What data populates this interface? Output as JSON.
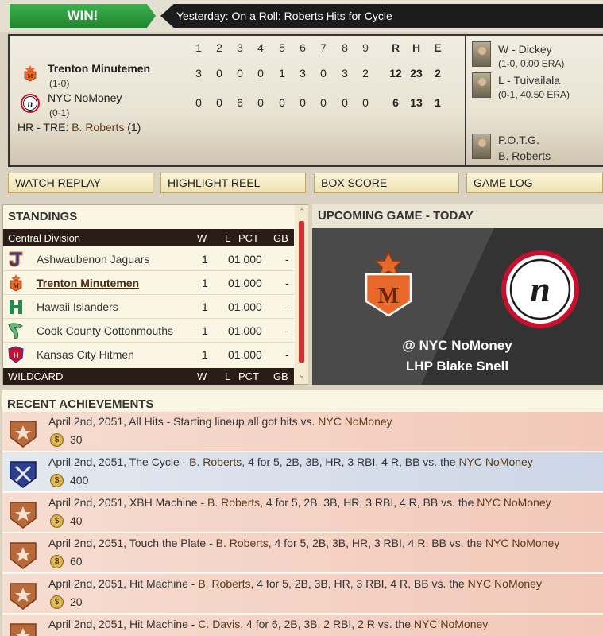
{
  "top": {
    "result": "WIN!",
    "headline": "Yesterday: On a Roll: Roberts Hits for Cycle"
  },
  "boxscore": {
    "innings": [
      "1",
      "2",
      "3",
      "4",
      "5",
      "6",
      "7",
      "8",
      "9"
    ],
    "rhe_labels": [
      "R",
      "H",
      "E"
    ],
    "teams": [
      {
        "name": "Trenton Minutemen",
        "record": "(1-0)",
        "innings": [
          "3",
          "0",
          "0",
          "0",
          "1",
          "3",
          "0",
          "3",
          "2"
        ],
        "r": "12",
        "h": "23",
        "e": "2"
      },
      {
        "name": "NYC NoMoney",
        "record": "(0-1)",
        "innings": [
          "0",
          "0",
          "6",
          "0",
          "0",
          "0",
          "0",
          "0",
          "0"
        ],
        "r": "6",
        "h": "13",
        "e": "1"
      }
    ],
    "hr_prefix": "HR - TRE:",
    "hr_player": "B. Roberts",
    "hr_count": "(1)",
    "win_pitcher": "W - Dickey",
    "win_line": "(1-0, 0.00 ERA)",
    "loss_pitcher": "L - Tuivailala",
    "loss_line": "(0-1, 40.50 ERA)",
    "potg_label": "P.O.T.G.",
    "potg_name": "B. Roberts"
  },
  "actions": {
    "watch": "WATCH REPLAY",
    "highlight": "HIGHLIGHT REEL",
    "box": "BOX SCORE",
    "log": "GAME LOG"
  },
  "standings": {
    "title": "STANDINGS",
    "division": "Central Division",
    "col_w": "W",
    "col_l": "L",
    "col_pct": "PCT",
    "col_gb": "GB",
    "rows": [
      {
        "team": "Ashwaubenon Jaguars",
        "w": "1",
        "pct": "01.000",
        "gb": "-"
      },
      {
        "team": "Trenton Minutemen",
        "w": "1",
        "pct": "01.000",
        "gb": "-"
      },
      {
        "team": "Hawaii Islanders",
        "w": "1",
        "pct": "01.000",
        "gb": "-"
      },
      {
        "team": "Cook County Cottonmouths",
        "w": "1",
        "pct": "01.000",
        "gb": "-"
      },
      {
        "team": "Kansas City Hitmen",
        "w": "1",
        "pct": "01.000",
        "gb": "-"
      }
    ],
    "wildcard": "WILDCARD"
  },
  "upcoming": {
    "title": "UPCOMING GAME - TODAY",
    "opponent": "@ NYC NoMoney",
    "pitcher": "LHP Blake Snell"
  },
  "achievements": {
    "title": "RECENT ACHIEVEMENTS",
    "items": [
      {
        "text": "April 2nd, 2051, All Hits - Starting lineup all got hits vs.",
        "player": "",
        "detail": "",
        "opponent": "NYC NoMoney",
        "points": "30"
      },
      {
        "text": "April 2nd, 2051, The Cycle -",
        "player": "B. Roberts,",
        "detail": "4 for 5, 2B, 3B, HR, 3 RBI, 4 R, BB vs. the",
        "opponent": "NYC NoMoney",
        "points": "400"
      },
      {
        "text": "April 2nd, 2051, XBH Machine -",
        "player": "B. Roberts,",
        "detail": "4 for 5, 2B, 3B, HR, 3 RBI, 4 R, BB vs. the",
        "opponent": "NYC NoMoney",
        "points": "40"
      },
      {
        "text": "April 2nd, 2051, Touch the Plate -",
        "player": "B. Roberts,",
        "detail": "4 for 5, 2B, 3B, HR, 3 RBI, 4 R, BB vs. the",
        "opponent": "NYC NoMoney",
        "points": "60"
      },
      {
        "text": "April 2nd, 2051, Hit Machine -",
        "player": "B. Roberts,",
        "detail": "4 for 5, 2B, 3B, HR, 3 RBI, 4 R, BB vs. the",
        "opponent": "NYC NoMoney",
        "points": "20"
      },
      {
        "text": "April 2nd, 2051, Hit Machine -",
        "player": "C. Davis,",
        "detail": "4 for 6, 2B, 3B, 2 RBI, 2 R vs. the",
        "opponent": "NYC NoMoney",
        "points": ""
      }
    ]
  },
  "colors": {
    "win_green": "#23852f",
    "headline_bg": "#1c1c1c",
    "standings_header": "#2a1c16",
    "trenton_orange": "#e8682a",
    "nyc_red": "#c8102e"
  }
}
